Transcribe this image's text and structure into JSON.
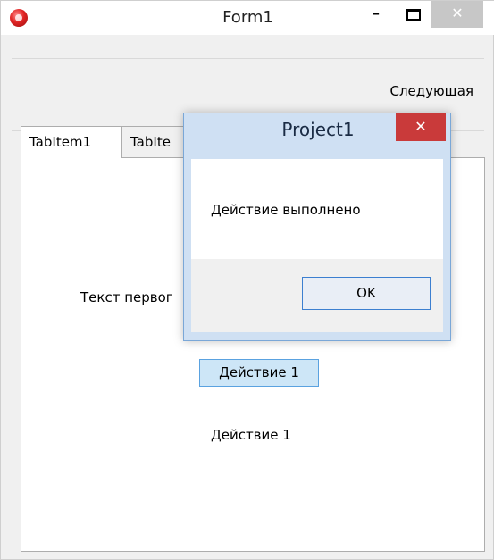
{
  "window": {
    "title": "Form1",
    "icon": "app-icon",
    "min_label": "–",
    "close_label": "✕"
  },
  "toolbar": {
    "next_label": "Следующая"
  },
  "tabs": [
    {
      "label": "TabItem1"
    },
    {
      "label": "TabIte"
    }
  ],
  "content": {
    "first_text": "Текст первог",
    "action_button": "Действие 1",
    "action_text": "Действие 1"
  },
  "dialog": {
    "title": "Project1",
    "close_label": "✕",
    "message": "Действие выполнено",
    "ok_label": "OK"
  }
}
